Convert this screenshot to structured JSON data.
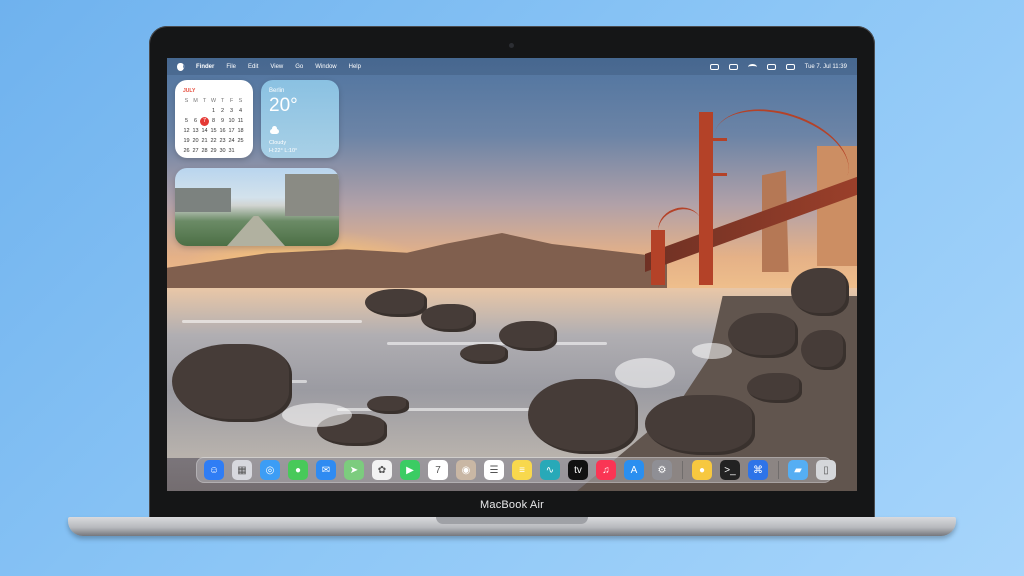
{
  "menu_bar": {
    "items": [
      "Finder",
      "File",
      "Edit",
      "View",
      "Go",
      "Window",
      "Help"
    ],
    "datetime": "Tue 7. Jul 11:39"
  },
  "widgets": {
    "calendar": {
      "month": "JULY",
      "weekdays": [
        "S",
        "M",
        "T",
        "W",
        "T",
        "F",
        "S"
      ],
      "days": [
        "",
        "",
        "",
        "1",
        "2",
        "3",
        "4",
        "5",
        "6",
        "7",
        "8",
        "9",
        "10",
        "11",
        "12",
        "13",
        "14",
        "15",
        "16",
        "17",
        "18",
        "19",
        "20",
        "21",
        "22",
        "23",
        "24",
        "25",
        "26",
        "27",
        "28",
        "29",
        "30",
        "31",
        ""
      ],
      "today": "7"
    },
    "weather": {
      "city": "Berlin",
      "temperature": "20°",
      "condition": "Cloudy",
      "range": "H:22° L:10°"
    }
  },
  "dock": {
    "apps": [
      {
        "name": "Finder",
        "icon": "finder-icon",
        "color": "#2f7df5",
        "glyph": "☺"
      },
      {
        "name": "Launchpad",
        "icon": "launchpad-icon",
        "color": "#d7d8de",
        "glyph": "▦"
      },
      {
        "name": "Safari",
        "icon": "safari-icon",
        "color": "#3c9df5",
        "glyph": "◎"
      },
      {
        "name": "Messages",
        "icon": "messages-icon",
        "color": "#48c95a",
        "glyph": "●"
      },
      {
        "name": "Mail",
        "icon": "mail-icon",
        "color": "#2f8bf2",
        "glyph": "✉"
      },
      {
        "name": "Maps",
        "icon": "maps-icon",
        "color": "#7ccc7e",
        "glyph": "➤"
      },
      {
        "name": "Photos",
        "icon": "photos-icon",
        "color": "#f2f2f2",
        "glyph": "✿"
      },
      {
        "name": "FaceTime",
        "icon": "facetime-icon",
        "color": "#3bcc63",
        "glyph": "▶"
      },
      {
        "name": "Calendar",
        "icon": "calendar-icon",
        "color": "#ffffff",
        "glyph": "7"
      },
      {
        "name": "Contacts",
        "icon": "contacts-icon",
        "color": "#c9b7a4",
        "glyph": "◉"
      },
      {
        "name": "Reminders",
        "icon": "reminders-icon",
        "color": "#ffffff",
        "glyph": "☰"
      },
      {
        "name": "Notes",
        "icon": "notes-icon",
        "color": "#f8d84d",
        "glyph": "≡"
      },
      {
        "name": "Freeform",
        "icon": "freeform-icon",
        "color": "#28a9b8",
        "glyph": "∿"
      },
      {
        "name": "TV",
        "icon": "tv-icon",
        "color": "#111111",
        "glyph": "tv"
      },
      {
        "name": "Music",
        "icon": "music-icon",
        "color": "#fa3554",
        "glyph": "♫"
      },
      {
        "name": "App Store",
        "icon": "app-store-icon",
        "color": "#2a8ff0",
        "glyph": "A"
      },
      {
        "name": "System Settings",
        "icon": "settings-icon",
        "color": "#8f8f95",
        "glyph": "⚙"
      },
      {
        "name": "Tips",
        "icon": "tips-icon",
        "color": "#f7c83f",
        "glyph": "●"
      },
      {
        "name": "Terminal",
        "icon": "terminal-icon",
        "color": "#222222",
        "glyph": ">_"
      },
      {
        "name": "Xcode",
        "icon": "xcode-icon",
        "color": "#2e74e8",
        "glyph": "⌘"
      },
      {
        "name": "Downloads",
        "icon": "downloads-folder-icon",
        "color": "#55aef3",
        "glyph": "▰"
      },
      {
        "name": "Trash",
        "icon": "trash-icon",
        "color": "#d5d7da",
        "glyph": "▯"
      }
    ]
  },
  "device_label": "MacBook Air"
}
